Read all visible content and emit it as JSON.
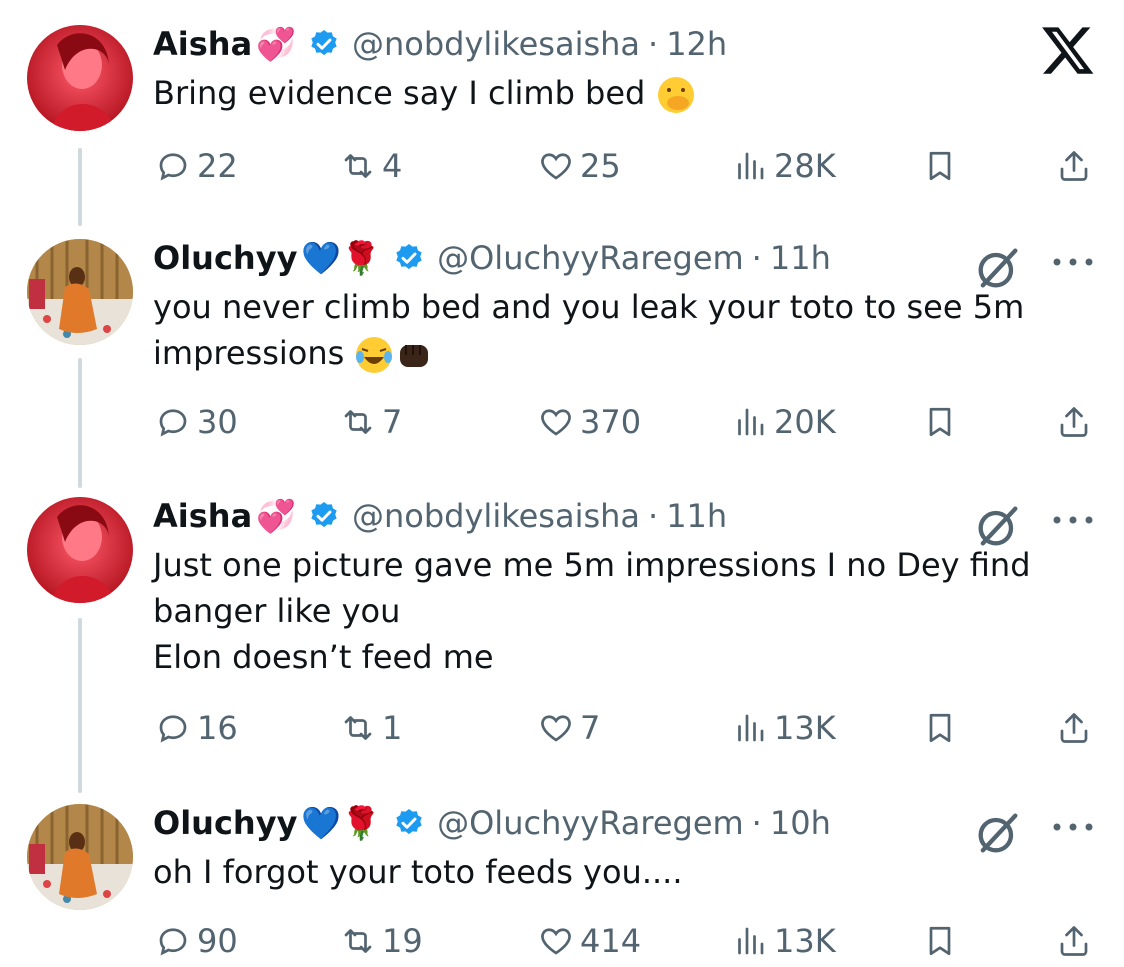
{
  "app": {
    "logo": "x-logo-icon"
  },
  "tweets": [
    {
      "name": "Aisha",
      "name_emoji": "💞",
      "handle": "@nobdylikesaisha",
      "sep": "·",
      "time": "12h",
      "text": "Bring evidence say I climb bed",
      "reply_count": "22",
      "retweet_count": "4",
      "like_count": "25",
      "view_count": "28K"
    },
    {
      "name": "Oluchyy",
      "name_emoji": "💙🌹",
      "handle": "@OluchyyRaregem",
      "sep": "·",
      "time": "11h",
      "text_line1": "you never climb bed and you leak your toto to see 5m",
      "text_line2": "impressions",
      "reply_count": "30",
      "retweet_count": "7",
      "like_count": "370",
      "view_count": "20K"
    },
    {
      "name": "Aisha",
      "name_emoji": "💞",
      "handle": "@nobdylikesaisha",
      "sep": "·",
      "time": "11h",
      "text": "Just one picture gave me 5m impressions I no Dey find\nbanger like you\nElon doesn’t feed me",
      "reply_count": "16",
      "retweet_count": "1",
      "like_count": "7",
      "view_count": "13K"
    },
    {
      "name": "Oluchyy",
      "name_emoji": "💙🌹",
      "handle": "@OluchyyRaregem",
      "sep": "·",
      "time": "10h",
      "text": "oh I forgot your toto feeds you....",
      "reply_count": "90",
      "retweet_count": "19",
      "like_count": "414",
      "view_count": "13K"
    }
  ],
  "colors": {
    "verified": "#1d9bf0",
    "muted": "#536471",
    "text": "#0f1419"
  }
}
